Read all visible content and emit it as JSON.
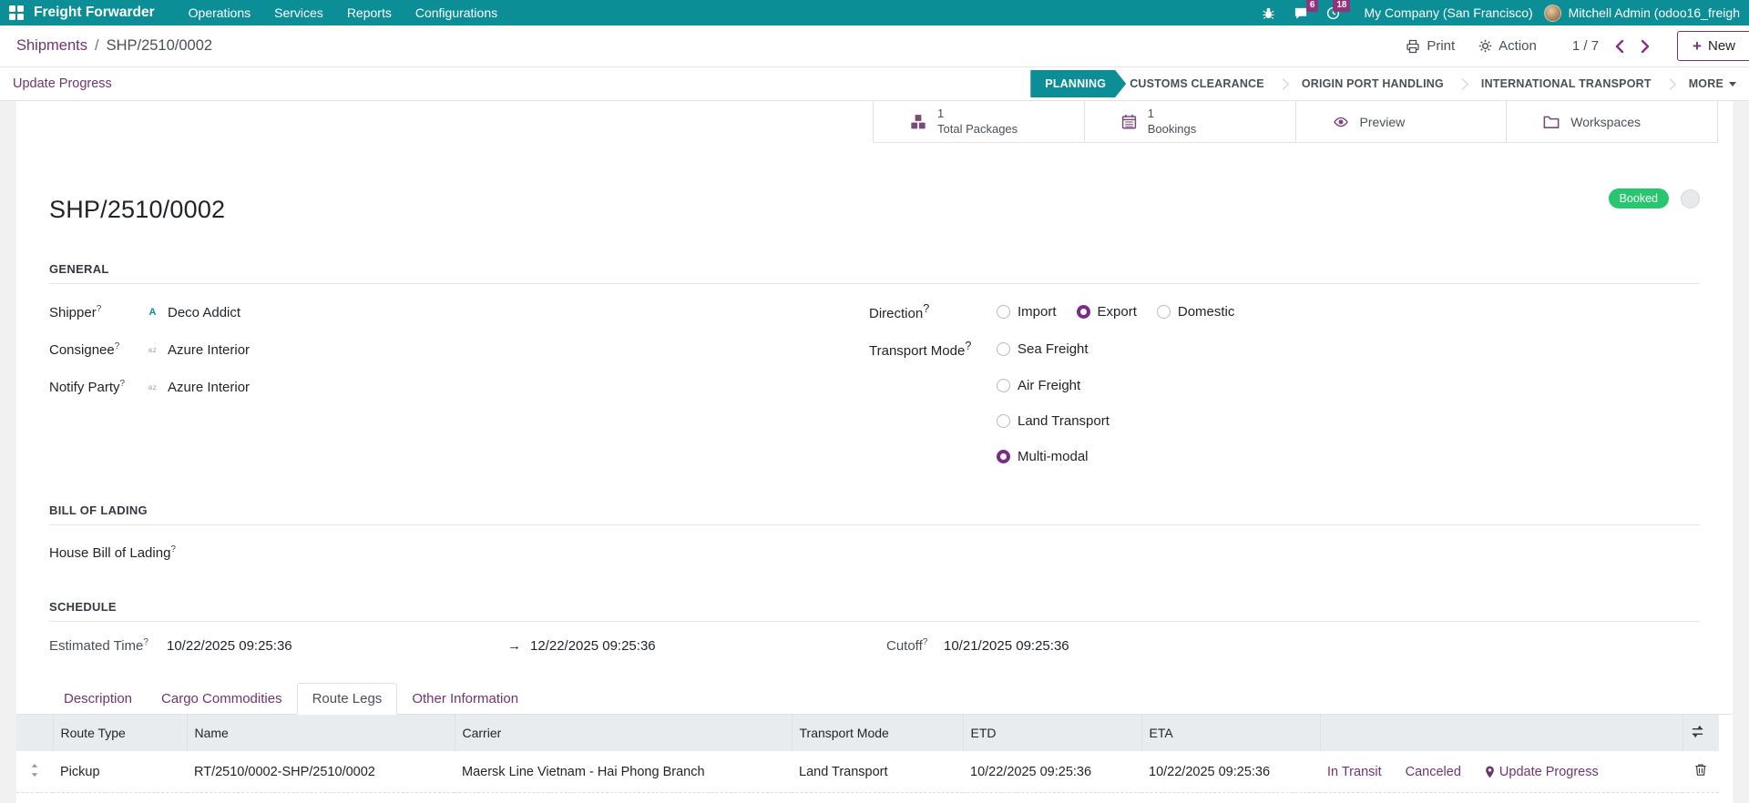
{
  "navbar": {
    "app_name": "Freight Forwarder",
    "menu_operations": "Operations",
    "menu_services": "Services",
    "menu_reports": "Reports",
    "menu_configurations": "Configurations",
    "messages_badge": "6",
    "activities_badge": "18",
    "company": "My Company (San Francisco)",
    "user": "Mitchell Admin (odoo16_freigh"
  },
  "control_panel": {
    "breadcrumb_parent": "Shipments",
    "breadcrumb_sep": "/",
    "breadcrumb_current": "SHP/2510/0002",
    "print_label": "Print",
    "action_label": "Action",
    "pager": "1 / 7",
    "new_plus": "+",
    "new_label": "New"
  },
  "statusbar": {
    "update_progress_label": "Update Progress",
    "stages": [
      {
        "label": "PLANNING",
        "active": true
      },
      {
        "label": "CUSTOMS CLEARANCE",
        "active": false
      },
      {
        "label": "ORIGIN PORT HANDLING",
        "active": false
      },
      {
        "label": "INTERNATIONAL TRANSPORT",
        "active": false
      },
      {
        "label": "MORE",
        "active": false
      }
    ]
  },
  "smart_buttons": {
    "packages_value": "1",
    "packages_label": "Total Packages",
    "bookings_value": "1",
    "bookings_label": "Bookings",
    "preview_label": "Preview",
    "workspaces_label": "Workspaces"
  },
  "record": {
    "title": "SHP/2510/0002",
    "badge": "Booked"
  },
  "general": {
    "heading": "GENERAL",
    "help_marker": "?",
    "shipper_label": "Shipper",
    "shipper_value": "Deco Addict",
    "shipper_logo": "A",
    "consignee_label": "Consignee",
    "consignee_value": "Azure Interior",
    "consignee_logo": "az",
    "notify_label": "Notify Party",
    "notify_value": "Azure Interior",
    "notify_logo": "az",
    "direction_label": "Direction",
    "direction_options": [
      "Import",
      "Export",
      "Domestic"
    ],
    "direction_selected": "Export",
    "transport_label": "Transport Mode",
    "transport_options": [
      "Sea Freight",
      "Air Freight",
      "Land Transport",
      "Multi-modal"
    ],
    "transport_selected": "Multi-modal"
  },
  "bill_of_lading": {
    "heading": "BILL OF LADING",
    "house_bl_label": "House Bill of Lading"
  },
  "schedule": {
    "heading": "SCHEDULE",
    "estimated_label": "Estimated Time",
    "start": "10/22/2025 09:25:36",
    "arrow": "→",
    "end": "12/22/2025 09:25:36",
    "cutoff_label": "Cutoff",
    "cutoff": "10/21/2025 09:25:36"
  },
  "tabs": [
    {
      "label": "Description",
      "active": false
    },
    {
      "label": "Cargo Commodities",
      "active": false
    },
    {
      "label": "Route Legs",
      "active": true
    },
    {
      "label": "Other Information",
      "active": false
    }
  ],
  "route_legs": {
    "columns": [
      "Route Type",
      "Name",
      "Carrier",
      "Transport Mode",
      "ETD",
      "ETA"
    ],
    "rows": [
      {
        "route_type": "Pickup",
        "name": "RT/2510/0002-SHP/2510/0002",
        "carrier": "Maersk Line Vietnam - Hai Phong Branch",
        "transport_mode": "Land Transport",
        "etd": "10/22/2025 09:25:36",
        "eta": "10/22/2025 09:25:36",
        "actions": [
          "In Transit",
          "Canceled",
          "Update Progress"
        ]
      }
    ]
  },
  "colors": {
    "navbar_teal": "#0b8e96",
    "accent_purple": "#71346f",
    "vivid_purple": "#8a2e8a",
    "radio_purple": "#7b2d85",
    "badge_green": "#28c76f",
    "badge_magenta": "#93327a",
    "table_header_bg": "#e9ecef"
  }
}
